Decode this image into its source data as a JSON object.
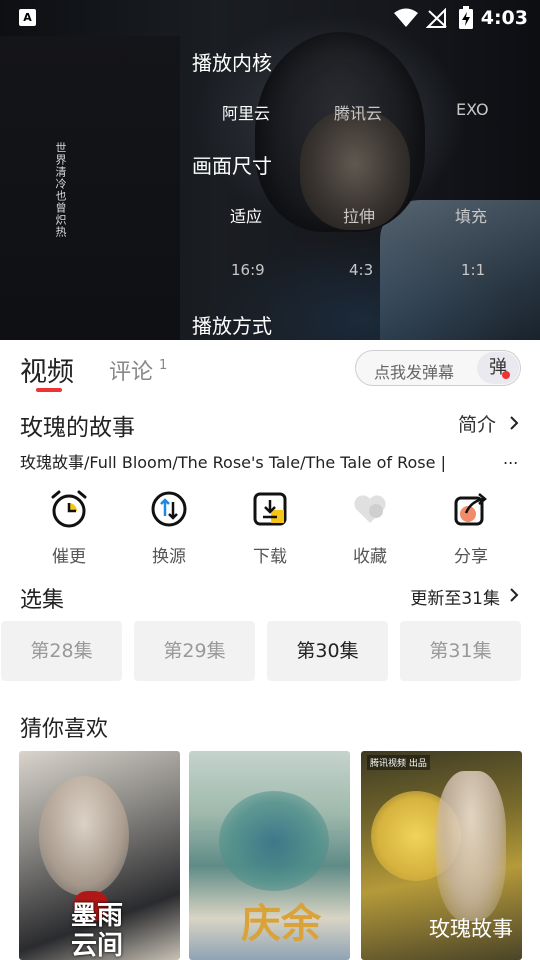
{
  "status_bar": {
    "app_icon_letter": "A",
    "time": "4:03"
  },
  "player": {
    "vertical_text": "世界清冷也曾炽热",
    "menu": {
      "kernel_title": "播放内核",
      "kernel_options": [
        "阿里云",
        "腾讯云",
        "EXO"
      ],
      "size_title": "画面尺寸",
      "size_options": [
        "适应",
        "拉伸",
        "填充"
      ],
      "ratio_options": [
        "16:9",
        "4:3",
        "1:1"
      ],
      "mode_title": "播放方式"
    }
  },
  "tabs": {
    "video": "视频",
    "comment": "评论",
    "comment_count": "1"
  },
  "danmu": {
    "placeholder": "点我发弹幕",
    "button": "弹"
  },
  "show": {
    "title": "玫瑰的故事",
    "intro_label": "简介",
    "alias": "玫瑰故事/Full Bloom/The Rose's Tale/The Tale of Rose |",
    "alias_more": "..."
  },
  "actions": [
    {
      "label": "催更",
      "icon": "alarm-clock-icon"
    },
    {
      "label": "换源",
      "icon": "switch-source-icon"
    },
    {
      "label": "下载",
      "icon": "download-icon"
    },
    {
      "label": "收藏",
      "icon": "heart-icon"
    },
    {
      "label": "分享",
      "icon": "share-icon"
    }
  ],
  "episodes": {
    "title": "选集",
    "update_text": "更新至31集",
    "items": [
      "第28集",
      "第29集",
      "第30集",
      "第31集"
    ],
    "active_index": 2
  },
  "recommend": {
    "title": "猜你喜欢",
    "posters": [
      {
        "text": "墨雨云间"
      },
      {
        "text": "庆余年"
      },
      {
        "text": "玫瑰故事",
        "badge": "腾讯视频 出品"
      }
    ]
  },
  "colors": {
    "accent": "#e53935",
    "icon_yellow": "#f5c518"
  }
}
